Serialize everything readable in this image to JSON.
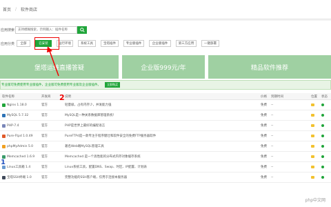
{
  "breadcrumb": {
    "home": "首页",
    "current": "软件商店"
  },
  "search": {
    "label": "应用搜索",
    "placeholder": "支持模糊搜索，示例输入：插件名称"
  },
  "categories": {
    "label": "应用分类",
    "items": [
      {
        "label": "全部",
        "active": false
      },
      {
        "label": "已安装",
        "active": true
      },
      {
        "label": "运行环境",
        "active": false
      },
      {
        "label": "系统工具",
        "active": false
      },
      {
        "label": "宝塔插件",
        "active": false
      },
      {
        "label": "专业版插件",
        "active": false
      },
      {
        "label": "企业版插件",
        "active": false
      },
      {
        "label": "第三方应用",
        "active": false
      },
      {
        "label": "一键部署",
        "active": false
      }
    ]
  },
  "banners": [
    "堡塔运维直播答疑",
    "企业版999元/年",
    "精品软件推荐"
  ],
  "notice": {
    "text": "专业版可免费使用专业版插件，企业版可免费使用专业版及企业版插件。",
    "button": "立即购买"
  },
  "table": {
    "headers": {
      "name": "软件名称",
      "dev": "开发商",
      "desc": "说明",
      "price": "价格",
      "expire": "到期时间",
      "loc": "位置",
      "status": "状态"
    },
    "rows": [
      {
        "name": "Nginx 1.18.0",
        "dev": "官方",
        "desc": "轻量级，占有内存少，并发能力强",
        "price": "免费",
        "expire": "--",
        "icon_color": "#20a53a"
      },
      {
        "name": "MySQL 5.7.32",
        "dev": "官方",
        "desc": "MySQL是一种关系数据库管理系统！",
        "price": "免费",
        "expire": "--",
        "icon_color": "#2d73b6"
      },
      {
        "name": "PHP-7.4",
        "dev": "官方",
        "desc": "PHP是世界上最好的编程语言",
        "price": "免费",
        "expire": "--",
        "icon_color": "#7a86b8"
      },
      {
        "name": "Pure-Ftpd 1.0.49",
        "dev": "官方",
        "desc": "PureFTPd是一款专注于程序健壮和软件安全的免费FTP服务器软件",
        "price": "免费",
        "expire": "--",
        "icon_color": "#e05a2a"
      },
      {
        "name": "phpMyAdmin 5.0",
        "dev": "官方",
        "desc": "著名Web端MySQL管理工具",
        "price": "免费",
        "expire": "--",
        "icon_color": "#f0a020"
      },
      {
        "name": "Memcached 1.6.9",
        "dev": "官方",
        "desc": "Memcached 是一个高性能的分布式内存对象缓存系统",
        "price": "免费",
        "expire": "--",
        "icon_color": "#3a9a6a"
      },
      {
        "name": "Linux工具箱 1.4",
        "dev": "官方",
        "desc": "Linux系统工具，配置DNS、Swap、时区、IP配置、计划表",
        "price": "免费",
        "expire": "--",
        "icon_color": "#6a9acf"
      },
      {
        "name": "宝塔SSH终端 1.0",
        "dev": "官方",
        "desc": "完整功能的SSH客户端，仅用于连接本服务器",
        "price": "免费",
        "expire": "--",
        "icon_color": "#404a5a"
      }
    ]
  },
  "annotations": {
    "step_number": "2",
    "side_mark": "1"
  },
  "watermark": "php中文网",
  "colors": {
    "accent": "#20a53a",
    "banner": "#9fd0a2",
    "annotation": "#e00000"
  }
}
